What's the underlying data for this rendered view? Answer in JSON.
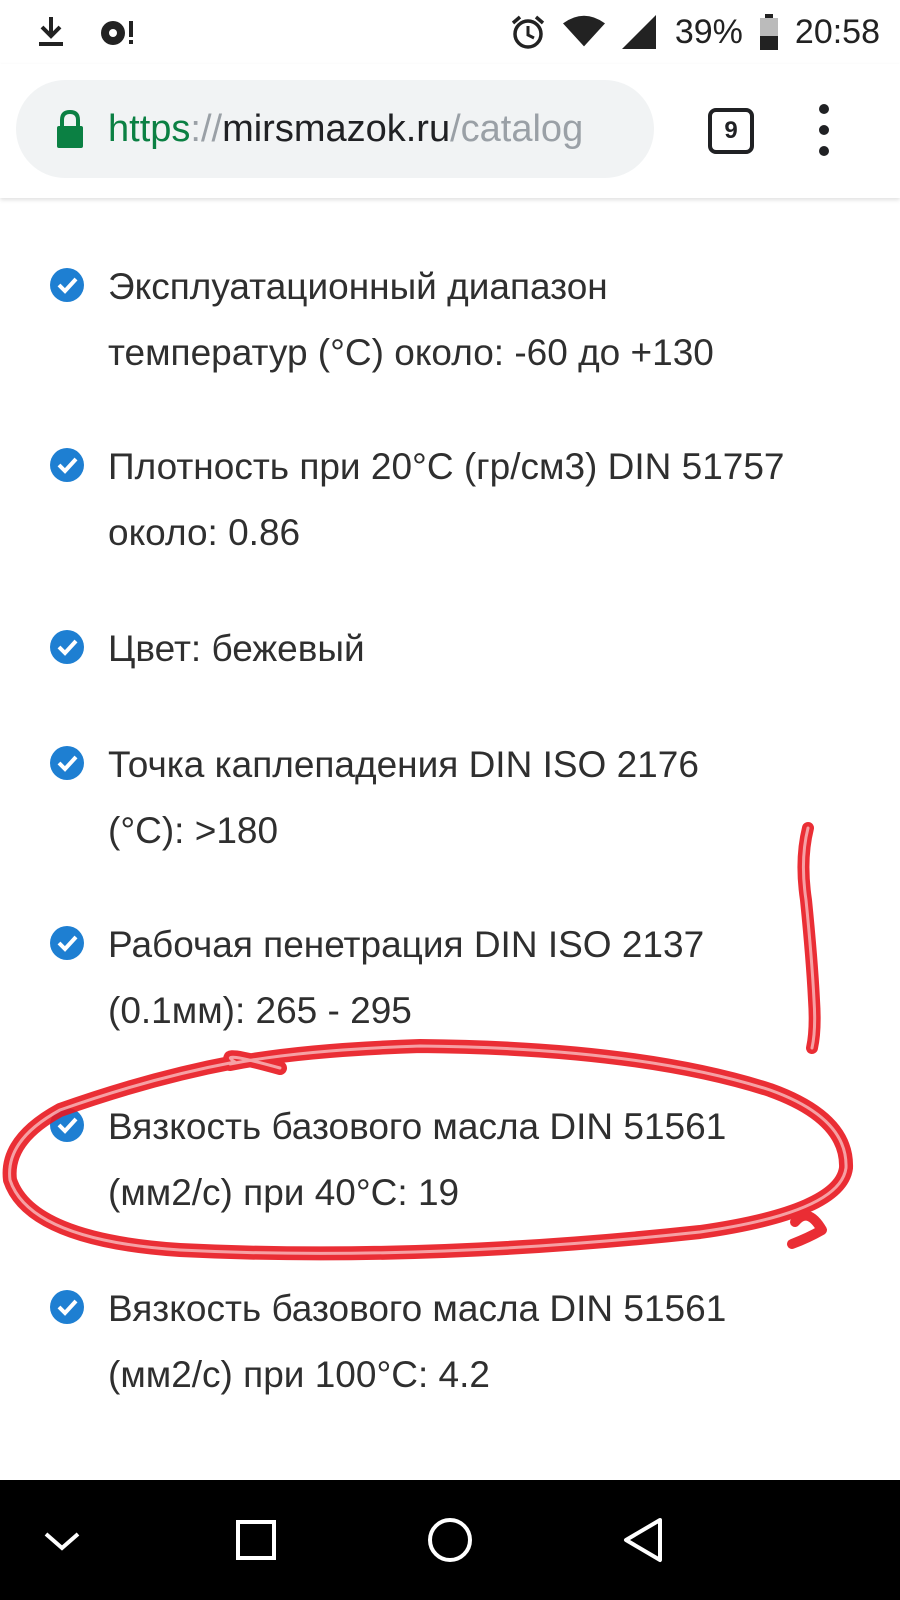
{
  "status_bar": {
    "battery": "39%",
    "time": "20:58",
    "icons_left": [
      "download-icon",
      "notification-icon"
    ],
    "icons_right": [
      "alarm-icon",
      "wifi-icon",
      "signal-icon",
      "battery-icon"
    ]
  },
  "browser": {
    "url": {
      "scheme": "https",
      "separator": "://",
      "host": "mirsmazok.ru",
      "path": "/catalog"
    },
    "tab_count": "9",
    "accent_color": "#0b8043"
  },
  "specs": [
    {
      "line1": "Эксплуатационный диапазон",
      "line2": "температур (°C) около: -60 до +130"
    },
    {
      "line1": "Плотность при 20°C (гр/см3) DIN 51757",
      "line2": "около: 0.86"
    },
    {
      "line1": "Цвет: бежевый",
      "line2": ""
    },
    {
      "line1": "Точка каплепадения DIN ISO 2176",
      "line2": "(°C): >180"
    },
    {
      "line1": "Рабочая пенетрация DIN ISO 2137",
      "line2": "(0.1мм): 265 - 295"
    },
    {
      "line1": "Вязкость базового масла DIN 51561",
      "line2": "(мм2/с) при 40°C: 19"
    },
    {
      "line1": "Вязкость базового масла DIN 51561",
      "line2": "(мм2/с) при 100°C: 4.2"
    }
  ],
  "colors": {
    "check": "#1e7fd2",
    "annotation": "#e8171f"
  },
  "nav_bar": {
    "buttons": [
      "collapse-icon",
      "home-square-icon",
      "home-circle-icon",
      "back-triangle-icon"
    ]
  }
}
